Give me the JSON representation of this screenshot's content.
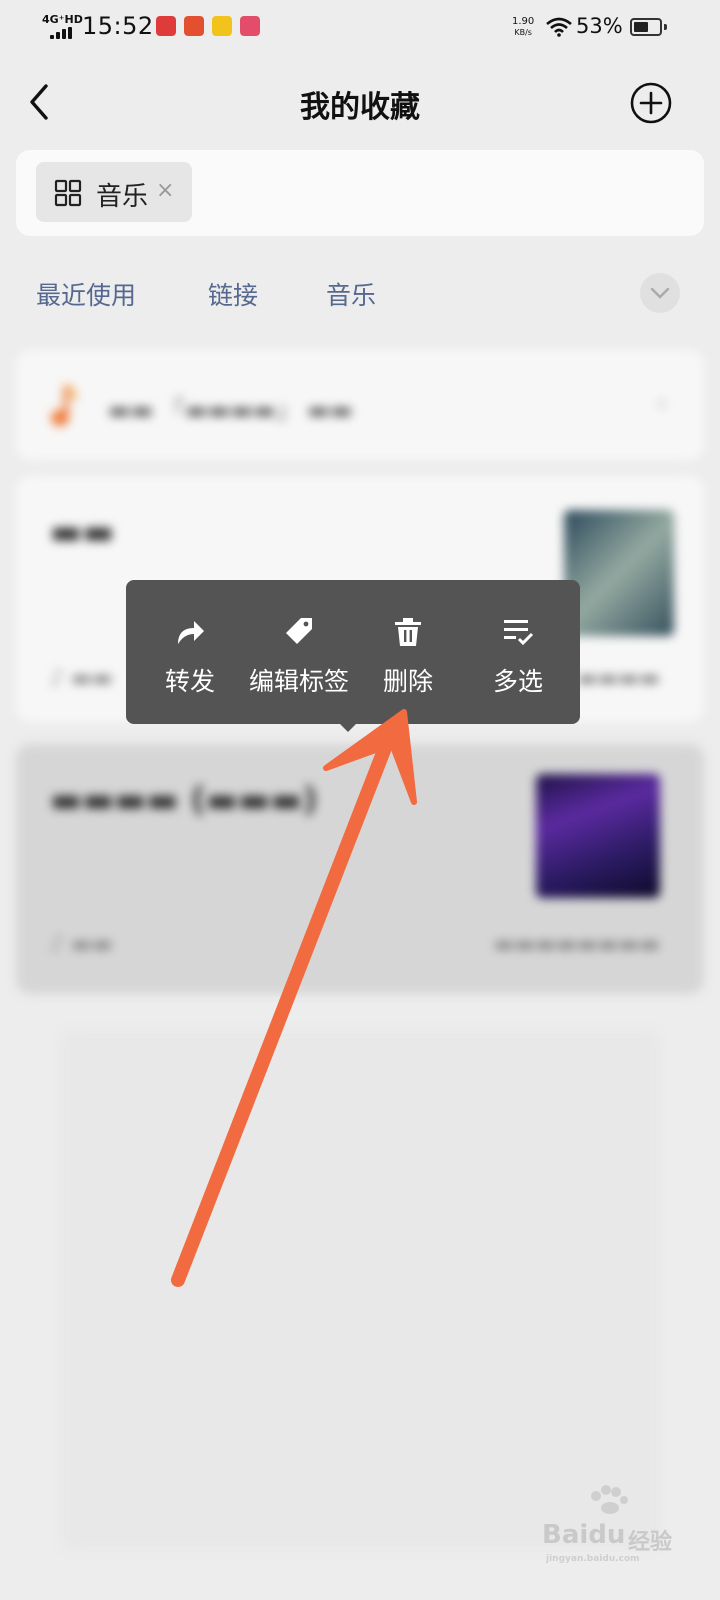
{
  "status_bar": {
    "network": "4G⁺HD",
    "time": "15:52",
    "speed_value": "1.90",
    "speed_unit": "KB/s",
    "battery": "53%",
    "notification_apps": [
      "toutiao-app-icon",
      "jd-app-icon",
      "kuaishou-app-icon",
      "pinduoduo-app-icon"
    ]
  },
  "nav": {
    "title": "我的收藏"
  },
  "tag_filter": {
    "chip_label": "音乐",
    "chip_close": "×"
  },
  "categories": {
    "tabs": [
      {
        "label": "最近使用"
      },
      {
        "label": "链接"
      },
      {
        "label": "音乐"
      }
    ]
  },
  "context_menu": {
    "items": [
      {
        "label": "转发",
        "icon": "forward-icon"
      },
      {
        "label": "编辑标签",
        "icon": "tag-icon"
      },
      {
        "label": "删除",
        "icon": "trash-icon"
      },
      {
        "label": "多选",
        "icon": "multi-select-icon"
      }
    ]
  },
  "colors": {
    "accent_tab": "#56688f",
    "menu_bg": "#545454",
    "arrow": "#f26a3f"
  },
  "watermark": {
    "brand": "Baidu",
    "suffix": "经验",
    "sub": "jingyan.baidu.com"
  }
}
